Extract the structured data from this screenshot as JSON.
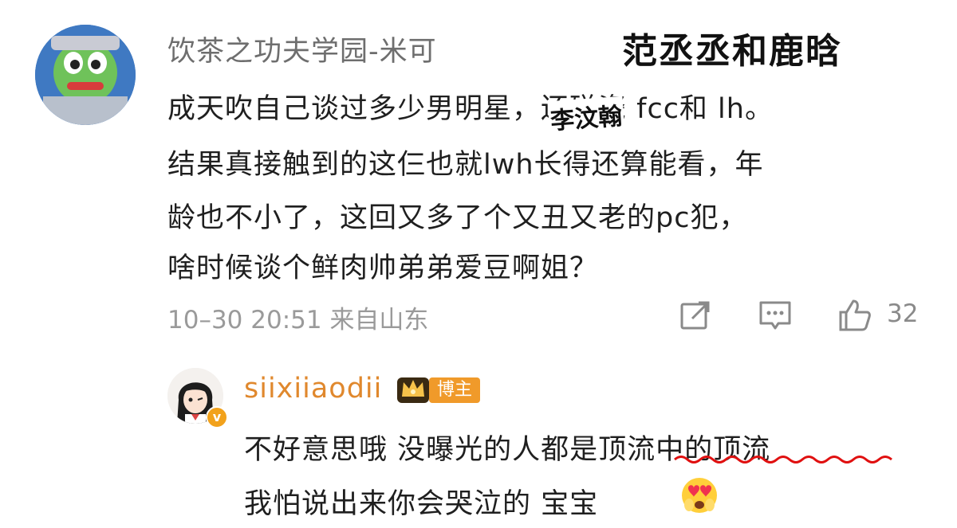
{
  "comment": {
    "username": "饮茶之功夫学园-米可",
    "overlay_title": "范丞丞和鹿晗",
    "lines": [
      "成天吹自己谈过多少男明星，还碰瓷 fcc和 lh。",
      "结果真接触到的这仨也就lwh长得还算能看，年",
      "龄也不小了，这回又多了个又丑又老的pc犯，",
      "啥时候谈个鲜肉帅弟弟爱豆啊姐？"
    ],
    "handwritten_note": "李汶翰",
    "timestamp": "10–30 20:51  来自山东",
    "like_count": "32",
    "icons": {
      "share": "share-icon",
      "comment": "comment-icon",
      "like": "thumbs-up-icon"
    }
  },
  "reply": {
    "username": "siixiiaodii",
    "tag": "博主",
    "verified_mark": "v",
    "lines": [
      "不好意思哦 没曝光的人都是顶流中的顶流",
      "我怕说出来你会哭泣的 宝宝"
    ],
    "icons": {
      "crown": "crown-badge-icon",
      "emoji": "heart-eyes-emoji-icon"
    }
  },
  "colors": {
    "username_gray": "#6e6e6e",
    "meta_gray": "#9a9a9a",
    "reply_username": "#e0882d",
    "tag_orange": "#f09a2a",
    "underline_red": "#e01010"
  }
}
